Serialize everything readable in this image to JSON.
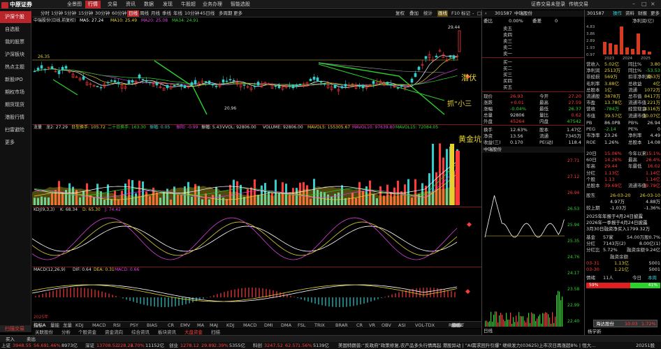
{
  "app": {
    "logo": "中原证券",
    "nav": [
      "全景图",
      "行情",
      "交易",
      "资讯",
      "数据",
      "发现",
      "牛股超",
      "业务办理",
      "智能选股"
    ],
    "active_nav": "行情",
    "topright": [
      "证券交易未登录",
      "传统交易"
    ]
  },
  "sidebar": {
    "items": [
      "沪深个股",
      "自选股",
      "我的股票",
      "沪深板块",
      "热点主题",
      "新股IPO",
      "期权市场",
      "期货现货",
      "港股行情",
      "扫雷避险",
      "更多"
    ],
    "active": "沪深个股",
    "bottom": "扫描交易"
  },
  "timeframe": {
    "items": [
      "分时",
      "1分钟",
      "5分钟",
      "15分钟",
      "30分钟",
      "60分钟",
      "日线",
      "周线",
      "月线",
      "季线",
      "年线",
      "10分钟",
      "45日线",
      "多周期",
      "更多"
    ],
    "active": "日线",
    "right": [
      "复权",
      "叠加",
      "统计",
      "画线",
      "F10",
      "标记",
      "-",
      "□"
    ]
  },
  "main": {
    "title": "中瑞股份(日线,前复权)",
    "ma": [
      {
        "label": "MA5: 27.24",
        "color": "#ffffff"
      },
      {
        "label": "MA10: 25.49",
        "color": "#e6d22f"
      },
      {
        "label": "MA20: 25.08",
        "color": "#e040e0"
      },
      {
        "label": "MA34: 24.91",
        "color": "#2bd32b"
      }
    ],
    "price_labels": [
      "29.44",
      "26.35",
      "20.96"
    ],
    "annotations": [
      "潜伏",
      "抓“小三",
      "黄金坑"
    ],
    "right_scale": [
      "27.71",
      "25.06",
      "22.40",
      "19.75",
      "17.10",
      "14.44",
      "11.79"
    ],
    "date_label": "2025年"
  },
  "volume": {
    "line1": [
      "龙量",
      "龙2: 27.29",
      "日型换手: 105.72",
      "二十日换手: 163.30",
      "振幅: 0.05",
      "振阳: -0.99",
      "振幅: 5.43",
      "VVOL: 92806.00",
      "VOLUME: 92806.00",
      "MAVOL5: 155305.67",
      "MAVOL10: 97639.80",
      "MAVOL15: 72084.05"
    ],
    "line1_colors": [
      "#ddd",
      "#ddd",
      "#e6d22f",
      "#2bd32b",
      "#3cc",
      "#e040e0",
      "#ddd",
      "#ddd",
      "#ddd",
      "#e6d22f",
      "#e040e0",
      "#2bd32b"
    ]
  },
  "kdj": {
    "labels": [
      "KDJ(9,3,3)",
      "K: 68.34",
      "D: 65.30",
      "J: 74.42"
    ]
  },
  "macd": {
    "labels": [
      "MACD(12,26,9)",
      "DIF: 0.64",
      "DEA: 0.31",
      "MACD: 0.66"
    ]
  },
  "bottom_tabs": [
    "指标A",
    "量能",
    "龙量",
    "KDJ",
    "MACD",
    "RSI",
    "PSY",
    "BIAS",
    "CR",
    "EMV",
    "MA",
    "MAJ",
    "KDJ",
    "MACD",
    "DMI",
    "DMA",
    "FSL",
    "TRIX",
    "BRAR",
    "CR",
    "VR",
    "OBV",
    "ASI",
    "VOL-TDX",
    "RSI",
    "WR",
    "SAR",
    "CCI",
    "ROC",
    "MTM",
    "BOLL",
    "PSY",
    "MCST",
    "龙线",
    "模板"
  ],
  "bottom_tabs2": [
    "关联股份",
    "分析",
    "个股资金",
    "资金流向",
    "综合资讯",
    "板块资讯",
    "大盘资金",
    "扫描"
  ],
  "quote": {
    "code": "301587",
    "name": "中瑞股份",
    "wb_label": "委比",
    "wb": "0.00%",
    "wc_label": "委差",
    "wc": "0",
    "sell": [
      "卖五",
      "卖四",
      "卖三",
      "卖二",
      "卖一"
    ],
    "buy": [
      "买一",
      "买二",
      "买三",
      "买四",
      "买五"
    ],
    "stats": [
      [
        "现价",
        "26.93",
        "今开",
        "27.20"
      ],
      [
        "涨跌",
        "+0.01",
        "最高",
        "27.59"
      ],
      [
        "涨幅",
        "-0.04%",
        "最低",
        "26.37"
      ],
      [
        "总量",
        "92806",
        "量比",
        "0.62"
      ],
      [
        "外盘",
        "45264",
        "内盘",
        "47542"
      ],
      [
        "换手",
        "12.63%",
        "股本",
        "1.47亿"
      ],
      [
        "净资",
        "13.56",
        "流通",
        "7345万"
      ],
      [
        "收益(三)",
        "0.170",
        "PE(动)",
        "118.4"
      ]
    ],
    "mini_title": "中瑞股份",
    "mini_scale": [
      "27.71",
      "27.12",
      "26.94",
      "26.53",
      "25.94",
      "25.35",
      "24.76",
      "24.17",
      "23.58",
      "22.99",
      "22.40"
    ],
    "mini_pct": [
      "2.89%",
      "1.79%",
      "0.00%",
      "-1.49%",
      "-2.19%",
      "-4.38%",
      "-6.57%",
      "-8.76%",
      "-10.95%"
    ],
    "daily_label": "日线"
  },
  "fin": {
    "code": "301587",
    "tabs": [
      "操作",
      "资料",
      "财报",
      "更多"
    ],
    "chart_label": "净利润(亿)",
    "years": [
      "2023",
      "2024",
      "2025"
    ],
    "y_ticks": [
      "4.83",
      "3.86",
      "2.89",
      "1.93",
      "0.97"
    ],
    "rows": [
      [
        "营收入",
        "5.02亿",
        "同比%",
        "3.80"
      ],
      [
        "净利润",
        "2513万",
        "同比%",
        "-53.53"
      ],
      [
        "非经损",
        "569万",
        "扣非净利润",
        "663万"
      ],
      [
        "毛利率",
        "3.88亿",
        "总收益",
        "4亿"
      ],
      [
        "总股本",
        "1亿",
        "流通",
        "1072万"
      ],
      [
        "流通股",
        "3878万",
        "总市值",
        "8417万"
      ],
      [
        "市盈",
        "13.78亿",
        "流通市值",
        "221万"
      ],
      [
        "营收",
        "-784万",
        "经营现金",
        "4316万"
      ],
      [
        "市值",
        "39.57亿",
        "流通市值",
        "10.07亿"
      ]
    ],
    "metrics": [
      [
        "PB",
        "86.0PB",
        "PB%",
        "26.94"
      ],
      [
        "PEG",
        "-2.14",
        "PE%",
        "0"
      ],
      [
        "市净率",
        "23.26",
        "净利率",
        "4.49"
      ],
      [
        "ROE",
        "1.26%",
        "总股本",
        "14.08"
      ]
    ],
    "changes": [
      [
        "20日",
        "15.06%",
        "今年以来",
        "15.1%"
      ],
      [
        "60日",
        "14.26%",
        "最高",
        "26.4%"
      ],
      [
        "年高",
        "29.44",
        "年最低",
        "16.02"
      ],
      [
        "分红",
        "1.13亿",
        "",
        "1.14亿"
      ],
      [
        "个股",
        "1.13",
        "",
        "1.14亿"
      ],
      [
        "总股本",
        "39.69亿",
        "流通市值",
        "19.79亿"
      ]
    ],
    "dates": [
      [
        "股东",
        "26-03-20",
        "26-03-10"
      ],
      [
        "",
        "4.97万",
        "4.88万"
      ],
      [
        "较上期",
        "-1.03万",
        "-1.36%"
      ]
    ],
    "news": [
      "2025年年报于4月24日披露",
      "2026年一季报于4月24日披露",
      "3月30日融资净买入1799.32万"
    ],
    "mood": {
      "label": "情绪",
      "today": "今日",
      "this_week": "本周",
      "period": "11人",
      "up_pct": "59%",
      "down_pct": "41%"
    },
    "extra": [
      [
        "基金",
        "57家",
        "54.00万股",
        "0.7%"
      ],
      [
        "分红",
        "7143万(2)",
        "",
        "8.00亿(1)"
      ],
      [
        "分红比",
        "5.72%",
        "融资余额",
        "9.24亿"
      ]
    ],
    "margin_title": "融资余额",
    "margin_rows": [
      [
        "03-31",
        "1.13亿",
        "5001"
      ],
      [
        "03-30",
        "1.21亿",
        "5001"
      ]
    ],
    "caption": "海达股份",
    "caption_val": "10.03",
    "caption_pct": "1.72%",
    "footer_name": "杨学新"
  },
  "status": {
    "buy": "买入",
    "sell": "卖出",
    "ticks": [
      [
        "上证",
        "3948.55",
        "56.69",
        "1.46%",
        "8973亿"
      ],
      [
        "深证",
        "13708.52",
        "228.24",
        "1.70%",
        "11152亿"
      ],
      [
        "创业",
        "1278.12",
        "29.89",
        "2.39%",
        "5355亿"
      ],
      [
        "科创",
        "3247.52",
        "62.57",
        "1.56%",
        "5139亿"
      ]
    ],
    "news": "美国特朗普:“反政府”政策修复,农产品多头行情再起 港股异动 | \"AI需求回升引爆\" 继续发力(03625)上市次日再涨超8% | 恒大...",
    "time": "20251股"
  }
}
